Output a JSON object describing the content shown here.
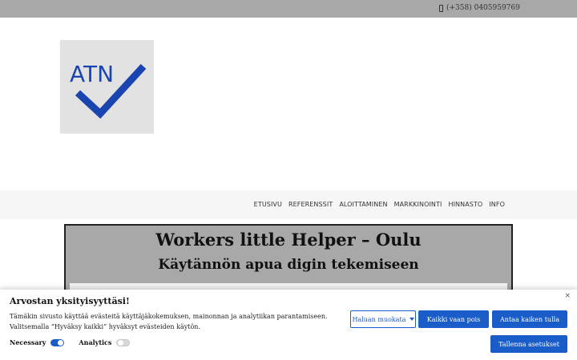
{
  "header": {
    "phone_icon": "phone-icon",
    "phone": "(+358) 0405959769"
  },
  "logo": {
    "text": "ATN",
    "colors": {
      "text": "#1a45b0",
      "check": "#1a45b0",
      "background": "#e2e2e2"
    }
  },
  "nav": {
    "items": [
      {
        "label": "ETUSIVU"
      },
      {
        "label": "REFERENSSIT"
      },
      {
        "label": "ALOITTAMINEN"
      },
      {
        "label": "MARKKINOINTI"
      },
      {
        "label": "HINNASTO"
      },
      {
        "label": "INFO"
      }
    ]
  },
  "hero": {
    "title": "Workers little Helper – Oulu",
    "subtitle": "Käytännön apua digin tekemiseen"
  },
  "cookie": {
    "close": "×",
    "title": "Arvostan yksityisyyttäsi!",
    "text": "Tämäkin sivusto käyttää evästeitä käyttäjäkokemuksen, mainonnan ja analytiikan parantamiseen. Valitsemalla “Hyväksy kaikki” hyväksyt evästeiden käytön.",
    "toggles": [
      {
        "label": "Necessary",
        "on": true
      },
      {
        "label": "Analytics",
        "on": false
      }
    ],
    "customize_label": "Haluan muokata",
    "reject_label": "Kaikki vaan pois",
    "accept_label": "Antaa kaiken tulla",
    "save_label": "Tallenna asetukset",
    "accent_color": "#1a5cc8"
  }
}
